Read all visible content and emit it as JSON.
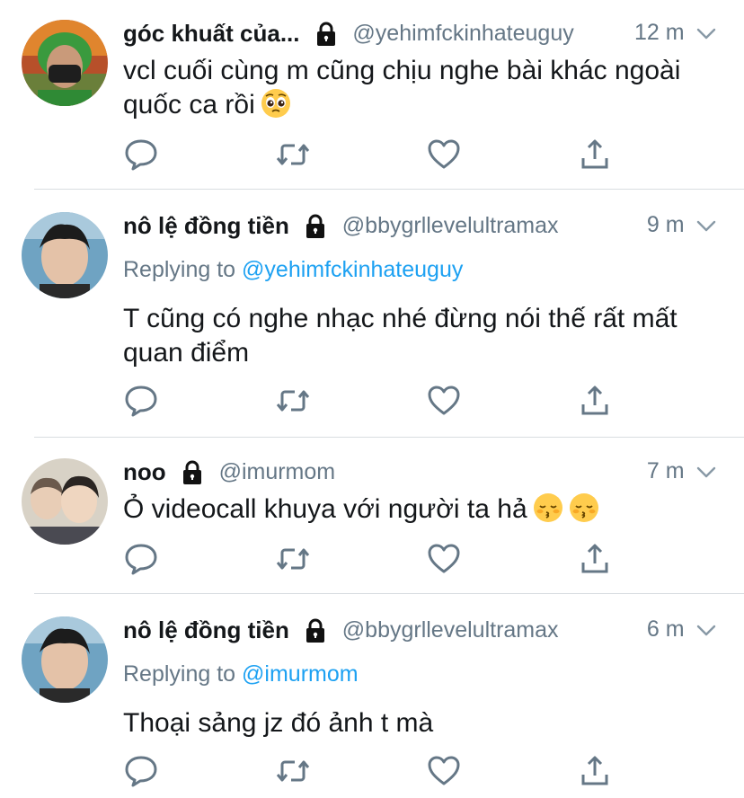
{
  "tweets": [
    {
      "name": "góc khuất của...",
      "handle": "@yehimfckinhateuguy",
      "time": "12 m",
      "replying_label": "",
      "replying_to": "",
      "text": "vcl cuối cùng m cũng chịu nghe bài khác ngoài quốc ca rồi",
      "emojis": [
        "pleading-face"
      ]
    },
    {
      "name": "nô lệ đồng tiền",
      "handle": "@bbygrllevelultramax",
      "time": "9 m",
      "replying_label": "Replying to",
      "replying_to": "@yehimfckinhateuguy",
      "text": "T cũng có nghe nhạc nhé đừng nói thế rất mất quan điểm",
      "emojis": []
    },
    {
      "name": "noo",
      "handle": "@imurmom",
      "time": "7 m",
      "replying_label": "",
      "replying_to": "",
      "text": "Ỏ videocall khuya với người ta hả",
      "emojis": [
        "kissing-closed-eyes-face",
        "kissing-closed-eyes-face"
      ]
    },
    {
      "name": "nô lệ đồng tiền",
      "handle": "@bbygrllevelultramax",
      "time": "6 m",
      "replying_label": "Replying to",
      "replying_to": "@imurmom",
      "text": "Thoại sảng jz đó ảnh t mà",
      "emojis": []
    }
  ],
  "icons": {
    "reply": "reply-icon",
    "retweet": "retweet-icon",
    "like": "heart-icon",
    "share": "share-icon",
    "lock": "lock-icon",
    "chevron": "chevron-down-icon"
  },
  "colors": {
    "text": "#14171a",
    "muted": "#657786",
    "link": "#1da1f2",
    "divider": "#d9dde1"
  }
}
